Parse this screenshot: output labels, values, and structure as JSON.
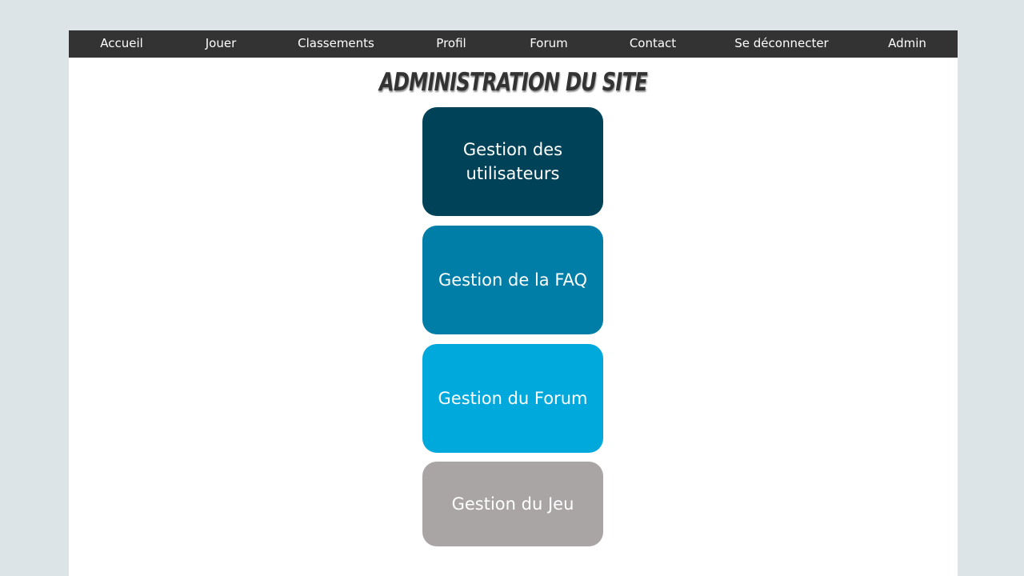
{
  "nav": {
    "items": [
      "Accueil",
      "Jouer",
      "Classements",
      "Profil",
      "Forum",
      "Contact",
      "Se déconnecter",
      "Admin"
    ]
  },
  "page": {
    "title": "Administration du site"
  },
  "tiles": [
    {
      "label": "Gestion des utilisateurs",
      "color": "#004358"
    },
    {
      "label": "Gestion de la FAQ",
      "color": "#007ea8"
    },
    {
      "label": "Gestion du Forum",
      "color": "#00a9dc"
    },
    {
      "label": "Gestion du Jeu",
      "color": "#a9a5a5"
    }
  ],
  "colors": {
    "background": "#dce4e8",
    "navbar": "#333333",
    "title": "#333333"
  }
}
